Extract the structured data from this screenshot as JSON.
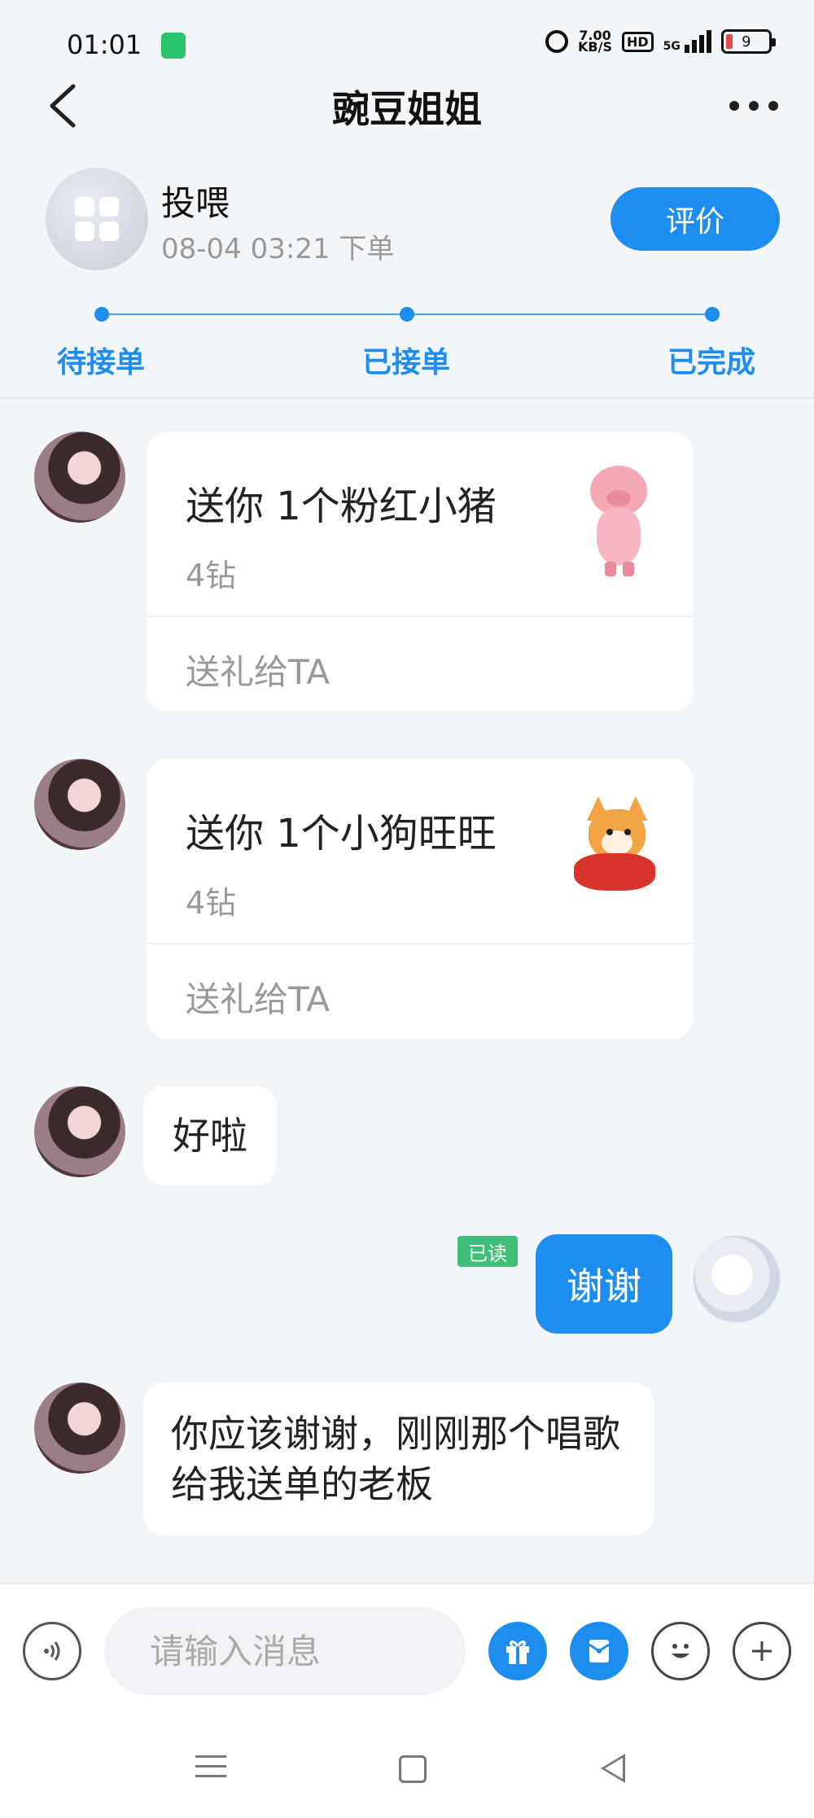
{
  "status_bar": {
    "time": "01:01",
    "net_speed_value": "7.00",
    "net_speed_unit": "KB/S",
    "hd_label": "HD",
    "network_label": "5G",
    "battery_level": "9"
  },
  "header": {
    "title": "豌豆姐姐"
  },
  "order": {
    "title": "投喂",
    "time": "08-04 03:21 下单",
    "rate_button": "评价"
  },
  "progress": {
    "steps": [
      "待接单",
      "已接单",
      "已完成"
    ]
  },
  "messages": {
    "gift1": {
      "title": "送你 1个粉红小猪",
      "price": "4钻",
      "action": "送礼给TA"
    },
    "gift2": {
      "title": "送你 1个小狗旺旺",
      "price": "4钻",
      "action": "送礼给TA"
    },
    "ok_text": "好啦",
    "thanks_text": "谢谢",
    "read_badge": "已读",
    "long_text": "你应该谢谢，刚刚那个唱歌给我送单的老板"
  },
  "input": {
    "placeholder": "请输入消息"
  },
  "colors": {
    "accent": "#1d8ef0",
    "read_badge": "#3ebf77",
    "background": "#f3f6f9"
  }
}
